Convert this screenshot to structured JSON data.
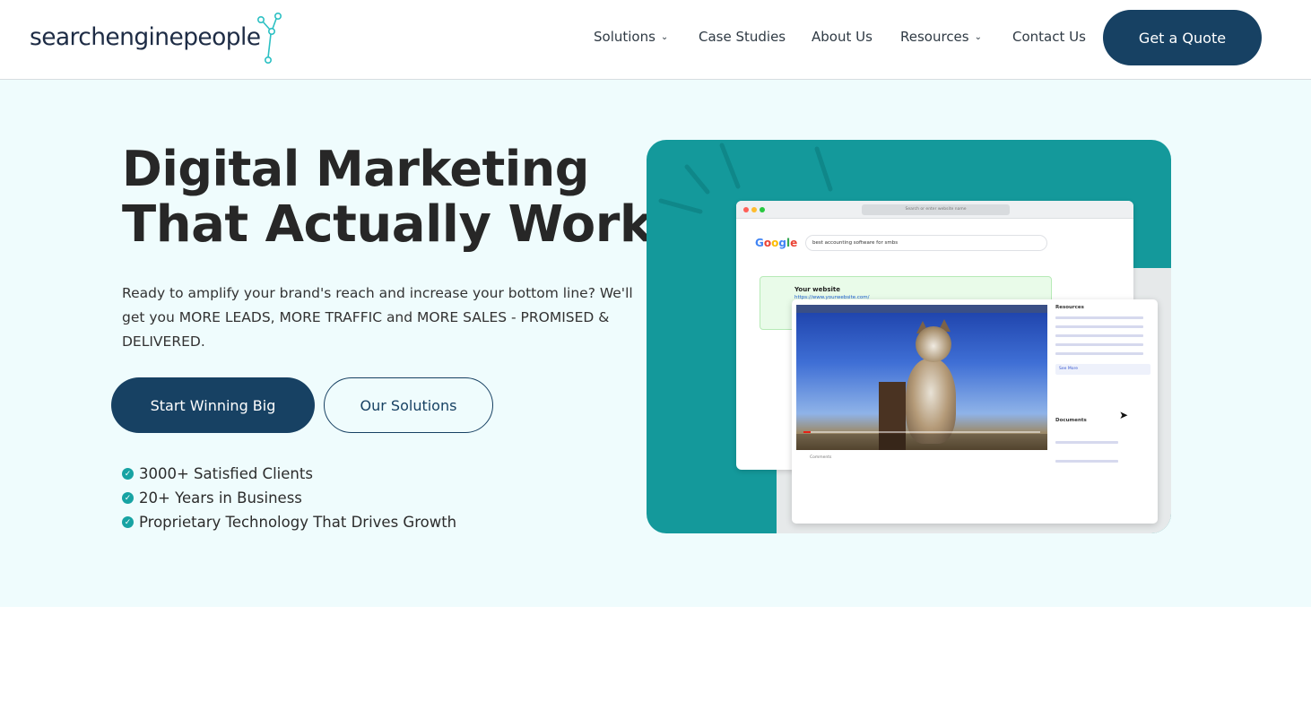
{
  "brand": {
    "logo_text": "searchenginepeople",
    "accent": "#174163",
    "teal": "#14999b"
  },
  "nav": {
    "items": [
      {
        "label": "Solutions",
        "has_dropdown": true
      },
      {
        "label": "Case Studies",
        "has_dropdown": false
      },
      {
        "label": "About Us",
        "has_dropdown": false
      },
      {
        "label": "Resources",
        "has_dropdown": true
      },
      {
        "label": "Contact Us",
        "has_dropdown": false
      }
    ],
    "cta_label": "Get a Quote"
  },
  "hero": {
    "heading_bold": "Digital Marketing",
    "heading_light": "That Actually Works",
    "subtext": "Ready to amplify your brand's reach and increase your bottom line? We'll get you MORE LEADS, MORE TRAFFIC and MORE SALES - PROMISED & DELIVERED.",
    "primary_button": "Start Winning Big",
    "secondary_button": "Our Solutions",
    "checks": [
      "3000+ Satisfied Clients",
      "20+ Years in Business",
      "Proprietary Technology That Drives Growth"
    ]
  },
  "illustration": {
    "url_placeholder": "Search or enter website name",
    "google_logo": "Google",
    "search_query": "best accounting software for smbs",
    "result_title": "Your website",
    "result_url": "https://www.yourwebsite.com/",
    "resources_label": "Resources",
    "see_more_label": "See More",
    "documents_label": "Documents",
    "comments_label": "Comments"
  }
}
